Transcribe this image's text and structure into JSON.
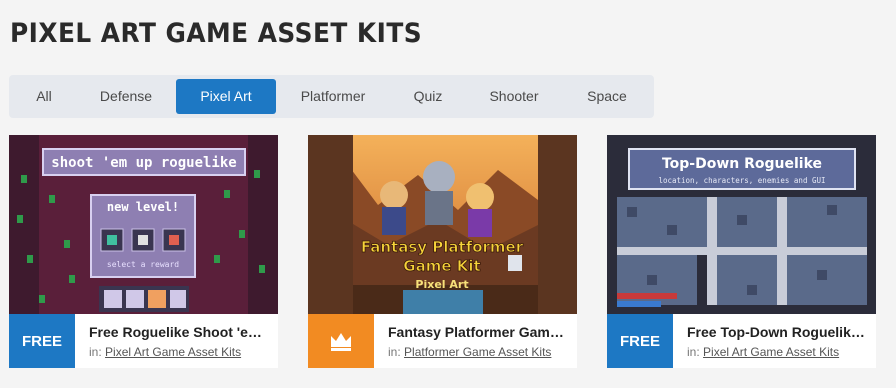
{
  "page": {
    "title": "PIXEL ART GAME ASSET KITS"
  },
  "tabs": [
    {
      "label": "All",
      "active": false
    },
    {
      "label": "Defense",
      "active": false
    },
    {
      "label": "Pixel Art",
      "active": true
    },
    {
      "label": "Platformer",
      "active": false
    },
    {
      "label": "Quiz",
      "active": false
    },
    {
      "label": "Shooter",
      "active": false
    },
    {
      "label": "Space",
      "active": false
    }
  ],
  "cards": [
    {
      "title": "Free Roguelike Shoot 'em Up Pixel Art Game Kit",
      "badge": "FREE",
      "category_prefix": "in:",
      "category": "Pixel Art Game Asset Kits",
      "thumb": {
        "heading": "shoot 'em up roguelike",
        "panel_title": "new level!",
        "panel_caption": "select a reward"
      }
    },
    {
      "title": "Fantasy Platformer Game Kit Pixel Art",
      "badge_icon": "crown-icon",
      "category_prefix": "in:",
      "category": "Platformer Game Asset Kits",
      "thumb": {
        "line1": "Fantasy Platformer",
        "line2": "Game Kit",
        "line3": "Pixel Art"
      }
    },
    {
      "title": "Free Top-Down Roguelike Game Kit Pixel Art",
      "badge": "FREE",
      "category_prefix": "in:",
      "category": "Pixel Art Game Asset Kits",
      "thumb": {
        "heading": "Top-Down Roguelike",
        "subheading": "location, characters, enemies and GUI"
      }
    }
  ],
  "colors": {
    "accent": "#1d78c4",
    "premium": "#f28b22"
  }
}
